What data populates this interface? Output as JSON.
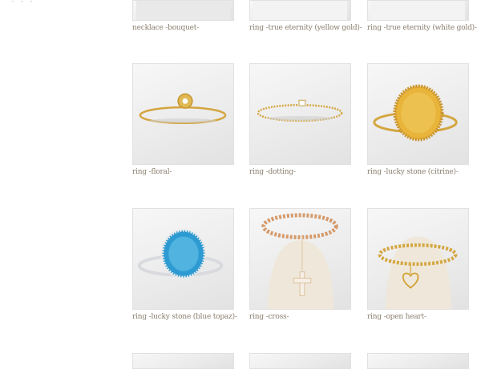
{
  "header": {
    "corner_mark": "· ·  ·"
  },
  "products": [
    {
      "id": "p1",
      "caption": "necklace -bouquet-",
      "icon": "necklace-photo"
    },
    {
      "id": "p2",
      "caption": "ring -true eternity (yellow gold)-",
      "icon": "ring-photo"
    },
    {
      "id": "p3",
      "caption": "ring -true eternity (white gold)-",
      "icon": "ring-photo"
    },
    {
      "id": "p4",
      "caption": "ring -floral-",
      "icon": "ring-photo"
    },
    {
      "id": "p5",
      "caption": "ring -dotting-",
      "icon": "ring-photo"
    },
    {
      "id": "p6",
      "caption": "ring -lucky stone (citrine)-",
      "icon": "ring-photo"
    },
    {
      "id": "p7",
      "caption": "ring -lucky stone (blue topaz)-",
      "icon": "ring-photo"
    },
    {
      "id": "p8",
      "caption": "ring -cross-",
      "icon": "ring-photo"
    },
    {
      "id": "p9",
      "caption": "ring -open heart-",
      "icon": "ring-photo"
    }
  ],
  "colors": {
    "gold": "#d4a640",
    "rose_gold": "#d59a6a",
    "silver": "#d8dadd",
    "citrine": "#e8b43a",
    "topaz": "#2e9ad2",
    "caption": "#8a7f6e"
  }
}
